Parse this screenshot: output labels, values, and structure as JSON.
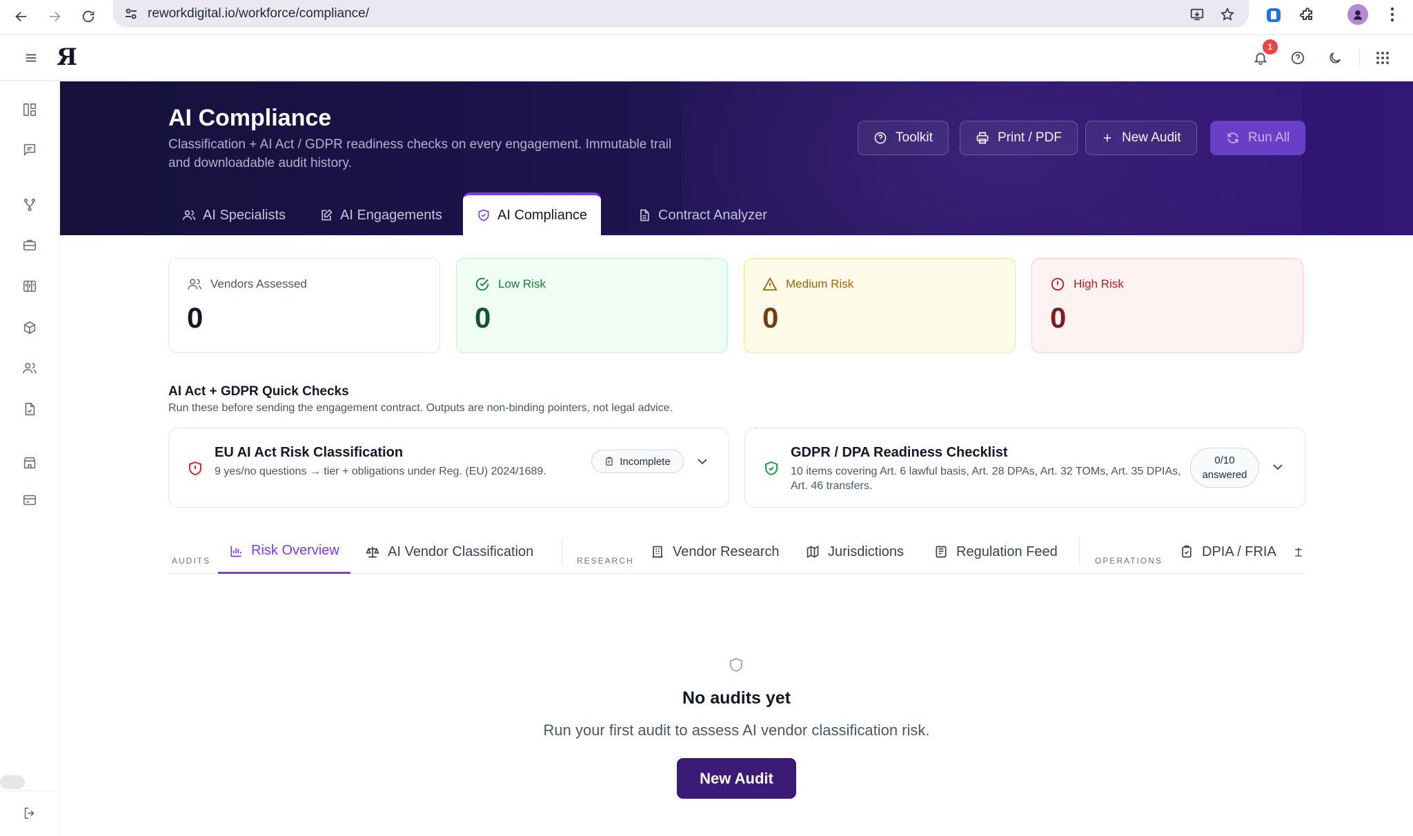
{
  "browser": {
    "url": "reworkdigital.io/workforce/compliance/"
  },
  "app": {
    "logo": "Я",
    "notifications_count": "1"
  },
  "hero": {
    "title": "AI Compliance",
    "subtitle": "Classification + AI Act / GDPR readiness checks on every engagement. Immutable trail and downloadable audit history.",
    "buttons": {
      "toolkit": "Toolkit",
      "print": "Print / PDF",
      "new_audit": "New Audit",
      "run_all": "Run All"
    },
    "tabs": [
      {
        "label": "AI Specialists"
      },
      {
        "label": "AI Engagements"
      },
      {
        "label": "AI Compliance"
      },
      {
        "label": "Contract Analyzer"
      }
    ],
    "active_tab": "AI Compliance"
  },
  "stats": [
    {
      "label": "Vendors Assessed",
      "value": "0"
    },
    {
      "label": "Low Risk",
      "value": "0"
    },
    {
      "label": "Medium Risk",
      "value": "0"
    },
    {
      "label": "High Risk",
      "value": "0"
    }
  ],
  "colors": {
    "accent": "#7c3aed",
    "low_risk": "#15803d",
    "medium_risk": "#a16207",
    "high_risk": "#b91c1c",
    "low_bg": "#f0fdf4",
    "medium_bg": "#fefce8",
    "high_bg": "#fef2f2"
  },
  "quick_checks": {
    "title": "AI Act + GDPR Quick Checks",
    "subtitle": "Run these before sending the engagement contract. Outputs are non-binding pointers, not legal advice.",
    "items": [
      {
        "name": "EU AI Act Risk Classification",
        "desc": "9 yes/no questions → tier + obligations under Reg. (EU) 2024/1689.",
        "status": "Incomplete"
      },
      {
        "name": "GDPR / DPA Readiness Checklist",
        "desc": "10 items covering Art. 6 lawful basis, Art. 28 DPAs, Art. 32 TOMs, Art. 35 DPIAs, Art. 46 transfers.",
        "status_count": "0/10",
        "status_label": "answered"
      }
    ]
  },
  "subtabs": {
    "groups": [
      "AUDITS",
      "RESEARCH",
      "OPERATIONS"
    ],
    "items": [
      {
        "label": "Risk Overview"
      },
      {
        "label": "AI Vendor Classification"
      },
      {
        "label": "Vendor Research"
      },
      {
        "label": "Jurisdictions"
      },
      {
        "label": "Regulation Feed"
      },
      {
        "label": "DPIA / FRIA"
      }
    ],
    "active": "Risk Overview"
  },
  "empty_state": {
    "title": "No audits yet",
    "subtitle": "Run your first audit to assess AI vendor classification risk.",
    "button": "New Audit"
  }
}
